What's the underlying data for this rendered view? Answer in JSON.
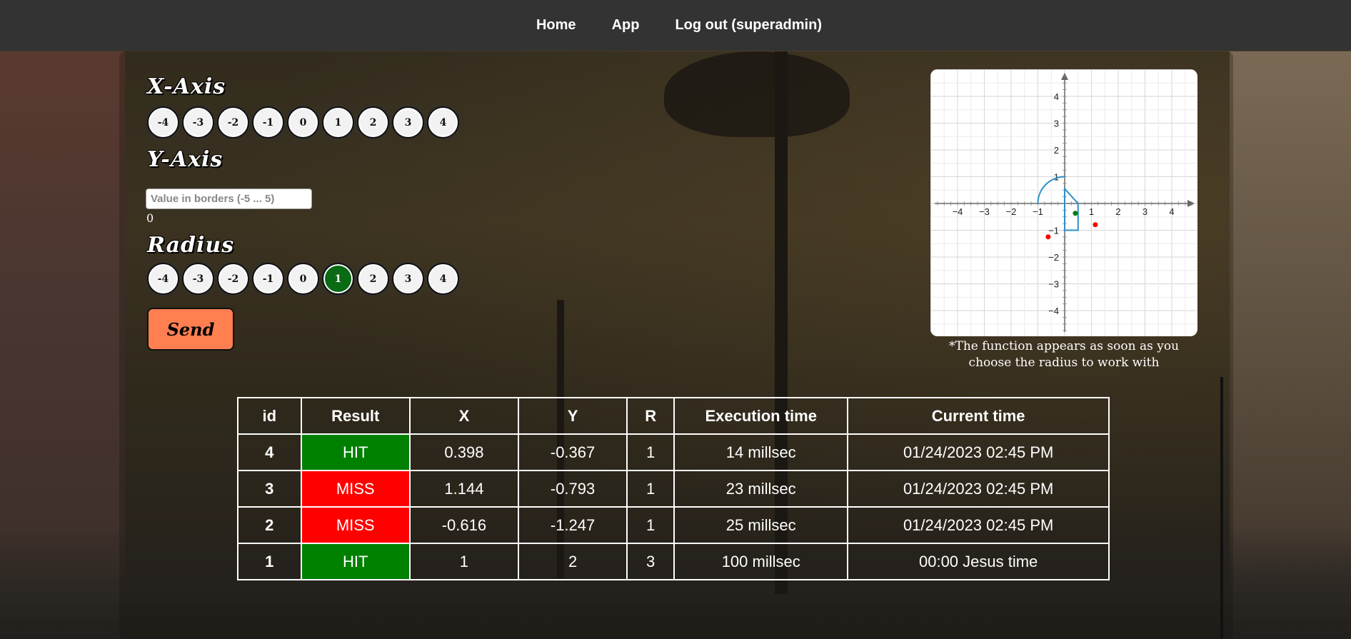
{
  "nav": {
    "home": "Home",
    "app": "App",
    "logout": "Log out (superadmin)"
  },
  "form": {
    "x_heading": "X-Axis",
    "x_values": [
      "-4",
      "-3",
      "-2",
      "-1",
      "0",
      "1",
      "2",
      "3",
      "4"
    ],
    "y_heading": "Y-Axis",
    "y_placeholder": "Value in borders (-5 ... 5)",
    "y_value": "0",
    "r_heading": "Radius",
    "r_values": [
      "-4",
      "-3",
      "-2",
      "-1",
      "0",
      "1",
      "2",
      "3",
      "4"
    ],
    "r_selected": "1",
    "send_label": "Send"
  },
  "graph": {
    "x_ticks": [
      "−4",
      "−3",
      "−2",
      "−1",
      "1",
      "2",
      "3",
      "4"
    ],
    "y_ticks": [
      "4",
      "3",
      "2",
      "1",
      "−1",
      "−2",
      "−3",
      "−4"
    ],
    "note": "*The function appears as soon as you choose the radius to work with",
    "points": [
      {
        "x": 0.398,
        "y": -0.367,
        "hit": true
      },
      {
        "x": 1.144,
        "y": -0.793,
        "hit": false
      },
      {
        "x": -0.616,
        "y": -1.247,
        "hit": false
      }
    ],
    "hit_color": "#008000",
    "miss_color": "#ff0000",
    "area_color": "#2a8fc7"
  },
  "table": {
    "headers": [
      "id",
      "Result",
      "X",
      "Y",
      "R",
      "Execution time",
      "Current time"
    ],
    "rows": [
      {
        "id": "4",
        "result": "HIT",
        "x": "0.398",
        "y": "-0.367",
        "r": "1",
        "exec": "14 millsec",
        "time": "01/24/2023 02:45 PM"
      },
      {
        "id": "3",
        "result": "MISS",
        "x": "1.144",
        "y": "-0.793",
        "r": "1",
        "exec": "23 millsec",
        "time": "01/24/2023 02:45 PM"
      },
      {
        "id": "2",
        "result": "MISS",
        "x": "-0.616",
        "y": "-1.247",
        "r": "1",
        "exec": "25 millsec",
        "time": "01/24/2023 02:45 PM"
      },
      {
        "id": "1",
        "result": "HIT",
        "x": "1",
        "y": "2",
        "r": "3",
        "exec": "100 millsec",
        "time": "00:00 Jesus time"
      }
    ]
  },
  "colors": {
    "nav_bg": "#333333",
    "selected_radius": "#0b6a14",
    "send_button": "#ff7f50",
    "hit": "#008000",
    "miss": "#ff0000"
  }
}
